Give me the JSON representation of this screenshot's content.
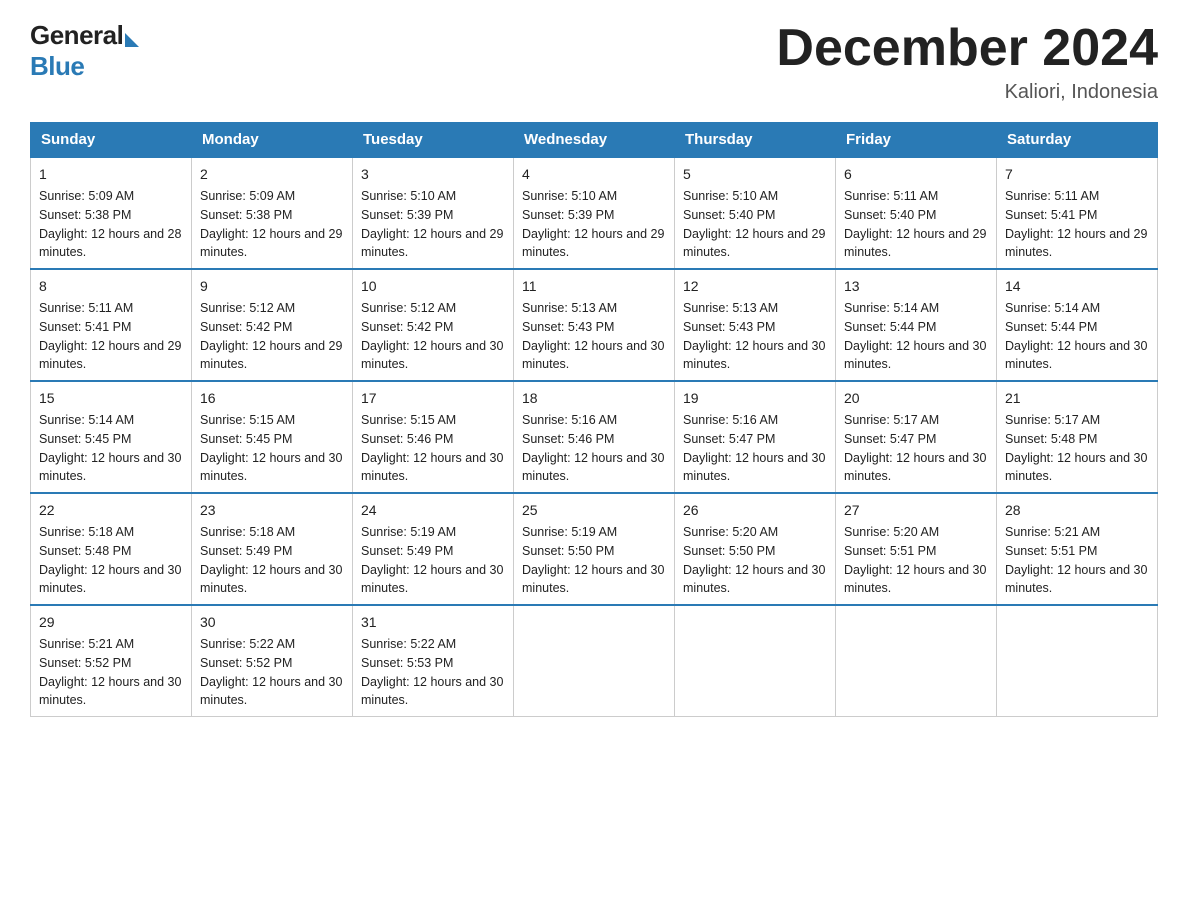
{
  "header": {
    "title": "December 2024",
    "location": "Kaliori, Indonesia",
    "logo_general": "General",
    "logo_blue": "Blue"
  },
  "weekdays": [
    "Sunday",
    "Monday",
    "Tuesday",
    "Wednesday",
    "Thursday",
    "Friday",
    "Saturday"
  ],
  "weeks": [
    [
      {
        "day": "1",
        "sunrise": "5:09 AM",
        "sunset": "5:38 PM",
        "daylight": "12 hours and 28 minutes."
      },
      {
        "day": "2",
        "sunrise": "5:09 AM",
        "sunset": "5:38 PM",
        "daylight": "12 hours and 29 minutes."
      },
      {
        "day": "3",
        "sunrise": "5:10 AM",
        "sunset": "5:39 PM",
        "daylight": "12 hours and 29 minutes."
      },
      {
        "day": "4",
        "sunrise": "5:10 AM",
        "sunset": "5:39 PM",
        "daylight": "12 hours and 29 minutes."
      },
      {
        "day": "5",
        "sunrise": "5:10 AM",
        "sunset": "5:40 PM",
        "daylight": "12 hours and 29 minutes."
      },
      {
        "day": "6",
        "sunrise": "5:11 AM",
        "sunset": "5:40 PM",
        "daylight": "12 hours and 29 minutes."
      },
      {
        "day": "7",
        "sunrise": "5:11 AM",
        "sunset": "5:41 PM",
        "daylight": "12 hours and 29 minutes."
      }
    ],
    [
      {
        "day": "8",
        "sunrise": "5:11 AM",
        "sunset": "5:41 PM",
        "daylight": "12 hours and 29 minutes."
      },
      {
        "day": "9",
        "sunrise": "5:12 AM",
        "sunset": "5:42 PM",
        "daylight": "12 hours and 29 minutes."
      },
      {
        "day": "10",
        "sunrise": "5:12 AM",
        "sunset": "5:42 PM",
        "daylight": "12 hours and 30 minutes."
      },
      {
        "day": "11",
        "sunrise": "5:13 AM",
        "sunset": "5:43 PM",
        "daylight": "12 hours and 30 minutes."
      },
      {
        "day": "12",
        "sunrise": "5:13 AM",
        "sunset": "5:43 PM",
        "daylight": "12 hours and 30 minutes."
      },
      {
        "day": "13",
        "sunrise": "5:14 AM",
        "sunset": "5:44 PM",
        "daylight": "12 hours and 30 minutes."
      },
      {
        "day": "14",
        "sunrise": "5:14 AM",
        "sunset": "5:44 PM",
        "daylight": "12 hours and 30 minutes."
      }
    ],
    [
      {
        "day": "15",
        "sunrise": "5:14 AM",
        "sunset": "5:45 PM",
        "daylight": "12 hours and 30 minutes."
      },
      {
        "day": "16",
        "sunrise": "5:15 AM",
        "sunset": "5:45 PM",
        "daylight": "12 hours and 30 minutes."
      },
      {
        "day": "17",
        "sunrise": "5:15 AM",
        "sunset": "5:46 PM",
        "daylight": "12 hours and 30 minutes."
      },
      {
        "day": "18",
        "sunrise": "5:16 AM",
        "sunset": "5:46 PM",
        "daylight": "12 hours and 30 minutes."
      },
      {
        "day": "19",
        "sunrise": "5:16 AM",
        "sunset": "5:47 PM",
        "daylight": "12 hours and 30 minutes."
      },
      {
        "day": "20",
        "sunrise": "5:17 AM",
        "sunset": "5:47 PM",
        "daylight": "12 hours and 30 minutes."
      },
      {
        "day": "21",
        "sunrise": "5:17 AM",
        "sunset": "5:48 PM",
        "daylight": "12 hours and 30 minutes."
      }
    ],
    [
      {
        "day": "22",
        "sunrise": "5:18 AM",
        "sunset": "5:48 PM",
        "daylight": "12 hours and 30 minutes."
      },
      {
        "day": "23",
        "sunrise": "5:18 AM",
        "sunset": "5:49 PM",
        "daylight": "12 hours and 30 minutes."
      },
      {
        "day": "24",
        "sunrise": "5:19 AM",
        "sunset": "5:49 PM",
        "daylight": "12 hours and 30 minutes."
      },
      {
        "day": "25",
        "sunrise": "5:19 AM",
        "sunset": "5:50 PM",
        "daylight": "12 hours and 30 minutes."
      },
      {
        "day": "26",
        "sunrise": "5:20 AM",
        "sunset": "5:50 PM",
        "daylight": "12 hours and 30 minutes."
      },
      {
        "day": "27",
        "sunrise": "5:20 AM",
        "sunset": "5:51 PM",
        "daylight": "12 hours and 30 minutes."
      },
      {
        "day": "28",
        "sunrise": "5:21 AM",
        "sunset": "5:51 PM",
        "daylight": "12 hours and 30 minutes."
      }
    ],
    [
      {
        "day": "29",
        "sunrise": "5:21 AM",
        "sunset": "5:52 PM",
        "daylight": "12 hours and 30 minutes."
      },
      {
        "day": "30",
        "sunrise": "5:22 AM",
        "sunset": "5:52 PM",
        "daylight": "12 hours and 30 minutes."
      },
      {
        "day": "31",
        "sunrise": "5:22 AM",
        "sunset": "5:53 PM",
        "daylight": "12 hours and 30 minutes."
      },
      null,
      null,
      null,
      null
    ]
  ]
}
